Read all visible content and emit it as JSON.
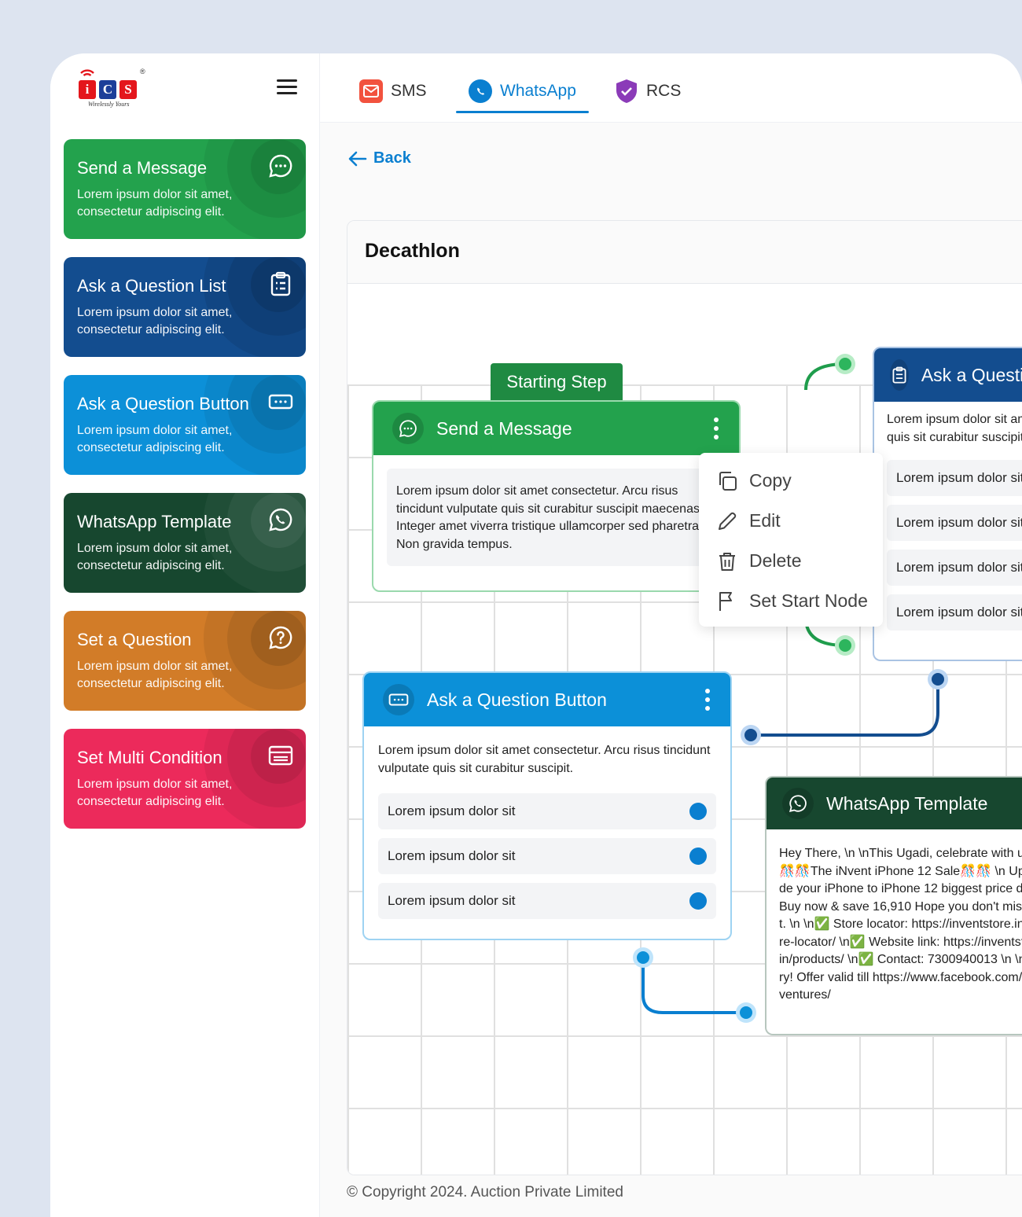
{
  "brand": {
    "logo_letters": [
      "i",
      "C",
      "S"
    ],
    "tagline": "Wirelessly Yours",
    "registered": "®"
  },
  "tabs": [
    {
      "label": "SMS",
      "icon": "mail-icon"
    },
    {
      "label": "WhatsApp",
      "icon": "whatsapp-icon",
      "active": true
    },
    {
      "label": "RCS",
      "icon": "shield-icon"
    }
  ],
  "sidebar": {
    "cards": [
      {
        "title": "Send a Message",
        "desc": "Lorem ipsum dolor sit amet, consectetur adipiscing elit.",
        "color": "#23a24d",
        "icon": "chat-icon"
      },
      {
        "title": "Ask a Question List",
        "desc": "Lorem ipsum dolor sit amet, consectetur adipiscing elit.",
        "color": "#134d8f",
        "icon": "clipboard-list-icon"
      },
      {
        "title": "Ask a Question Button",
        "desc": "Lorem ipsum dolor sit amet, consectetur adipiscing elit.",
        "color": "#0c90d8",
        "icon": "button-icon"
      },
      {
        "title": "WhatsApp Template",
        "desc": "Lorem ipsum dolor sit amet, consectetur adipiscing elit.",
        "color": "#17472f",
        "icon": "whatsapp-icon"
      },
      {
        "title": "Set a Question",
        "desc": "Lorem ipsum dolor sit amet, consectetur adipiscing elit.",
        "color": "#d27c28",
        "icon": "question-icon"
      },
      {
        "title": "Set Multi Condition",
        "desc": "Lorem ipsum dolor sit amet, consectetur adipiscing elit.",
        "color": "#ec2a5b",
        "icon": "condition-icon"
      }
    ]
  },
  "main": {
    "back_label": "Back",
    "flow_title": "Decathlon",
    "starting_step": "Starting Step",
    "send_node": {
      "title": "Send a Message",
      "text": "Lorem ipsum dolor sit amet consectetur. Arcu risus tincidunt vulputate quis sit curabitur suscipit maecenas. Integer amet viverra tristique ullamcorper sed pharetra. Non gravida tempus."
    },
    "list_node": {
      "title": "Ask a Question List",
      "text": "Lorem ipsum dolor sit amet consectetur. Arcu risus tincidunt vulputate quis sit curabitur suscipit.",
      "items": [
        "Lorem ipsum dolor sit",
        "Lorem ipsum dolor sit",
        "Lorem ipsum dolor sit",
        "Lorem ipsum dolor sit"
      ]
    },
    "button_node": {
      "title": "Ask a Question Button",
      "text": "Lorem ipsum dolor sit amet consectetur. Arcu risus tincidunt vulputate quis sit curabitur suscipit.",
      "options": [
        "Lorem ipsum dolor sit",
        "Lorem ipsum dolor sit",
        "Lorem ipsum dolor sit"
      ]
    },
    "template_node": {
      "title": "WhatsApp Template",
      "text": "Hey There, \\n  \\nThis Ugadi, celebrate with us at 🎊🎊The iNvent iPhone 12 Sale🎊🎊 \\n Upgrade your iPhone to iPhone 12 biggest price drop. Buy now & save 16,910 Hope you don't miss out. \\n \\n✅ Store locator: https://inventstore.in/store-locator/  \\n✅ Website link: https://inventstore.in/products/ \\n✅ Contact: 7300940013  \\n \\nHurry! Offer valid till https://www.facebook.com/p3sventures/"
    },
    "context_menu": [
      {
        "label": "Copy",
        "icon": "copy-icon"
      },
      {
        "label": "Edit",
        "icon": "pencil-icon"
      },
      {
        "label": "Delete",
        "icon": "trash-icon"
      },
      {
        "label": "Set Start Node",
        "icon": "flag-icon"
      }
    ],
    "footer": "© Copyright 2024. Auction  Private Limited"
  }
}
